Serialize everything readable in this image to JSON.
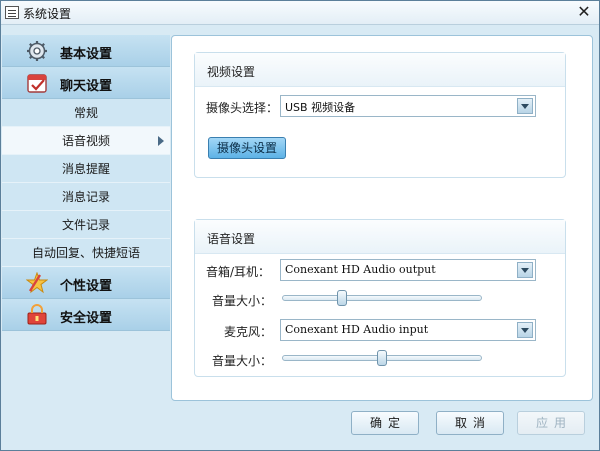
{
  "window": {
    "title": "系统设置",
    "close_glyph": "✕"
  },
  "sidebar": {
    "categories": [
      {
        "label": "基本设置",
        "icon": "gear-icon"
      },
      {
        "label": "聊天设置",
        "icon": "calendar-check-icon"
      }
    ],
    "subitems": [
      {
        "label": "常规"
      },
      {
        "label": "语音视频",
        "active": true
      },
      {
        "label": "消息提醒"
      },
      {
        "label": "消息记录"
      },
      {
        "label": "文件记录"
      },
      {
        "label": "自动回复、快捷短语"
      }
    ],
    "bottom_categories": [
      {
        "label": "个性设置",
        "icon": "star-brush-icon"
      },
      {
        "label": "安全设置",
        "icon": "shield-lock-icon"
      }
    ]
  },
  "video": {
    "section_title": "视频设置",
    "camera_label": "摄像头选择：",
    "camera_value": "USB 视频设备",
    "camera_settings_button": "摄像头设置"
  },
  "audio": {
    "section_title": "语音设置",
    "speaker_label": "音箱/耳机：",
    "speaker_value": "Conexant HD Audio output",
    "speaker_volume_label": "音量大小：",
    "speaker_volume": 0.3,
    "mic_label": "麦克风：",
    "mic_value": "Conexant HD Audio input",
    "mic_volume_label": "音量大小：",
    "mic_volume": 0.5
  },
  "buttons": {
    "ok": "确定",
    "cancel": "取消",
    "apply": "应用"
  },
  "colors": {
    "accent_button": "#5db2e6",
    "sidebar_bg": "#cfe6f3",
    "window_bg": "#d8eaf4"
  }
}
